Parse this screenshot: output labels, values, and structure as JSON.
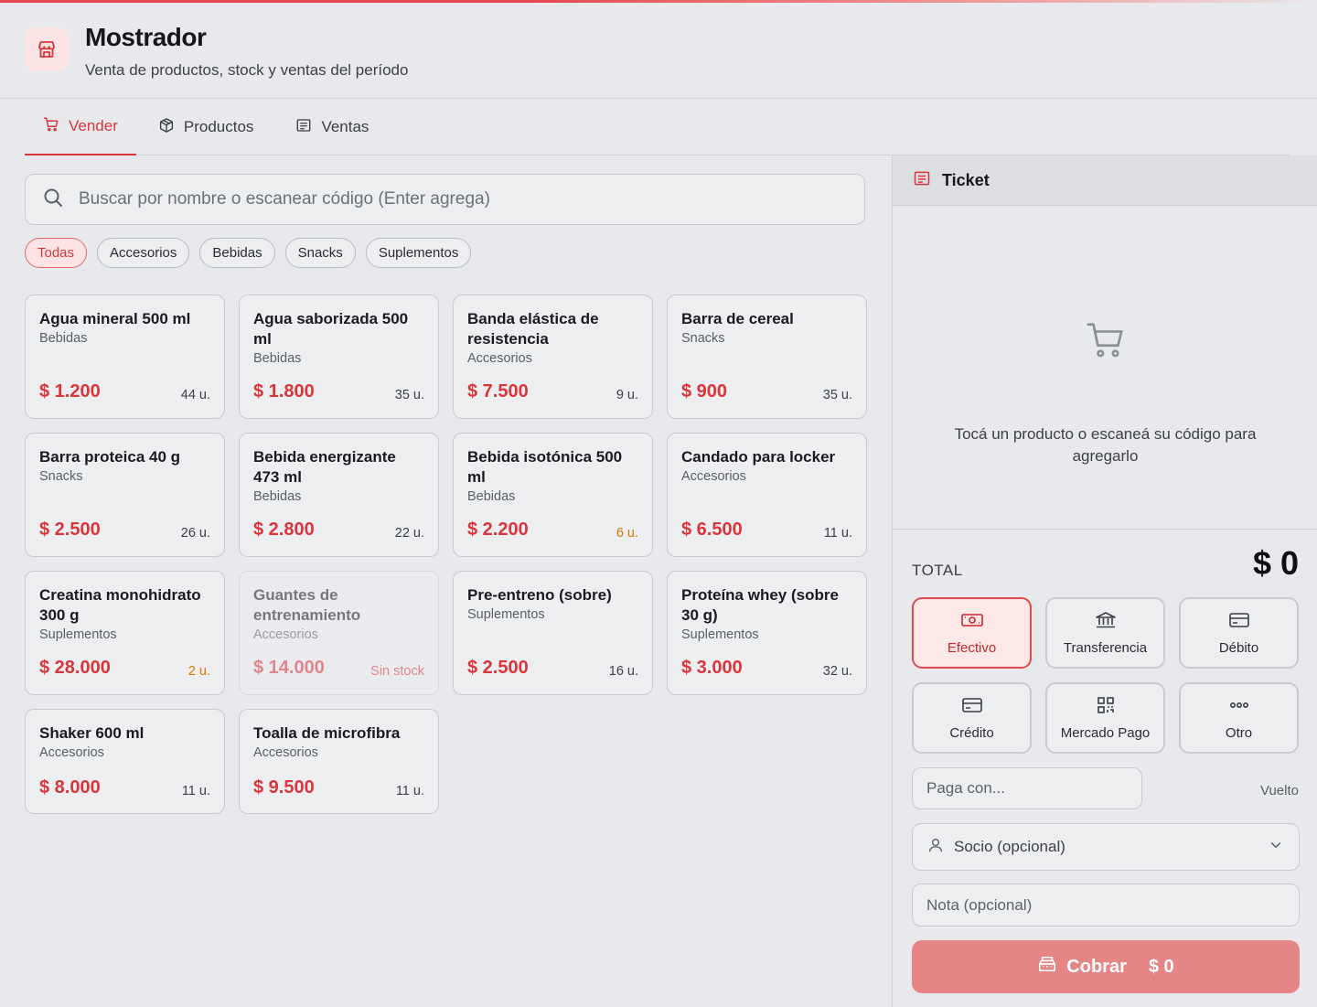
{
  "app": {
    "title": "Mostrador",
    "subtitle": "Venta de productos, stock y ventas del período",
    "accent_color": "#d9363c",
    "logo_icon": "store-icon"
  },
  "tabs": [
    {
      "label": "Vender",
      "icon": "cart-icon",
      "active": true
    },
    {
      "label": "Productos",
      "icon": "box-icon",
      "active": false
    },
    {
      "label": "Ventas",
      "icon": "receipt-icon",
      "active": false
    }
  ],
  "search": {
    "placeholder": "Buscar por nombre o escanear código (Enter agrega)",
    "value": ""
  },
  "categories": [
    {
      "label": "Todas",
      "active": true
    },
    {
      "label": "Accesorios",
      "active": false
    },
    {
      "label": "Bebidas",
      "active": false
    },
    {
      "label": "Snacks",
      "active": false
    },
    {
      "label": "Suplementos",
      "active": false
    }
  ],
  "products": [
    {
      "name": "Agua mineral 500 ml",
      "category": "Bebidas",
      "price": "$ 1.200",
      "stock": "44 u.",
      "status": "normal"
    },
    {
      "name": "Agua saborizada 500 ml",
      "category": "Bebidas",
      "price": "$ 1.800",
      "stock": "35 u.",
      "status": "normal"
    },
    {
      "name": "Banda elástica de resistencia",
      "category": "Accesorios",
      "price": "$ 7.500",
      "stock": "9 u.",
      "status": "normal"
    },
    {
      "name": "Barra de cereal",
      "category": "Snacks",
      "price": "$ 900",
      "stock": "35 u.",
      "status": "normal"
    },
    {
      "name": "Barra proteica 40 g",
      "category": "Snacks",
      "price": "$ 2.500",
      "stock": "26 u.",
      "status": "normal"
    },
    {
      "name": "Bebida energizante 473 ml",
      "category": "Bebidas",
      "price": "$ 2.800",
      "stock": "22 u.",
      "status": "normal"
    },
    {
      "name": "Bebida isotónica 500 ml",
      "category": "Bebidas",
      "price": "$ 2.200",
      "stock": "6 u.",
      "status": "low"
    },
    {
      "name": "Candado para locker",
      "category": "Accesorios",
      "price": "$ 6.500",
      "stock": "11 u.",
      "status": "normal"
    },
    {
      "name": "Creatina monohidrato 300 g",
      "category": "Suplementos",
      "price": "$ 28.000",
      "stock": "2 u.",
      "status": "low"
    },
    {
      "name": "Guantes de entrenamiento",
      "category": "Accesorios",
      "price": "$ 14.000",
      "stock": "Sin stock",
      "status": "out"
    },
    {
      "name": "Pre-entreno (sobre)",
      "category": "Suplementos",
      "price": "$ 2.500",
      "stock": "16 u.",
      "status": "normal"
    },
    {
      "name": "Proteína whey (sobre 30 g)",
      "category": "Suplementos",
      "price": "$ 3.000",
      "stock": "32 u.",
      "status": "normal"
    },
    {
      "name": "Shaker 600 ml",
      "category": "Accesorios",
      "price": "$ 8.000",
      "stock": "11 u.",
      "status": "normal"
    },
    {
      "name": "Toalla de microfibra",
      "category": "Accesorios",
      "price": "$ 9.500",
      "stock": "11 u.",
      "status": "normal"
    }
  ],
  "ticket": {
    "title": "Ticket",
    "empty_text": "Tocá un producto o escaneá su código para agregarlo",
    "total_label": "TOTAL",
    "total_value": "$ 0",
    "payment_methods": [
      {
        "label": "Efectivo",
        "icon": "cash-icon",
        "active": true
      },
      {
        "label": "Transferencia",
        "icon": "bank-icon",
        "active": false
      },
      {
        "label": "Débito",
        "icon": "debit-card-icon",
        "active": false
      },
      {
        "label": "Crédito",
        "icon": "credit-card-icon",
        "active": false
      },
      {
        "label": "Mercado Pago",
        "icon": "qr-icon",
        "active": false
      },
      {
        "label": "Otro",
        "icon": "more-icon",
        "active": false
      }
    ],
    "paga_con_placeholder": "Paga con...",
    "vuelto_label": "Vuelto",
    "socio_placeholder": "Socio (opcional)",
    "nota_placeholder": "Nota (opcional)",
    "cobrar_label": "Cobrar",
    "cobrar_amount": "$ 0"
  }
}
